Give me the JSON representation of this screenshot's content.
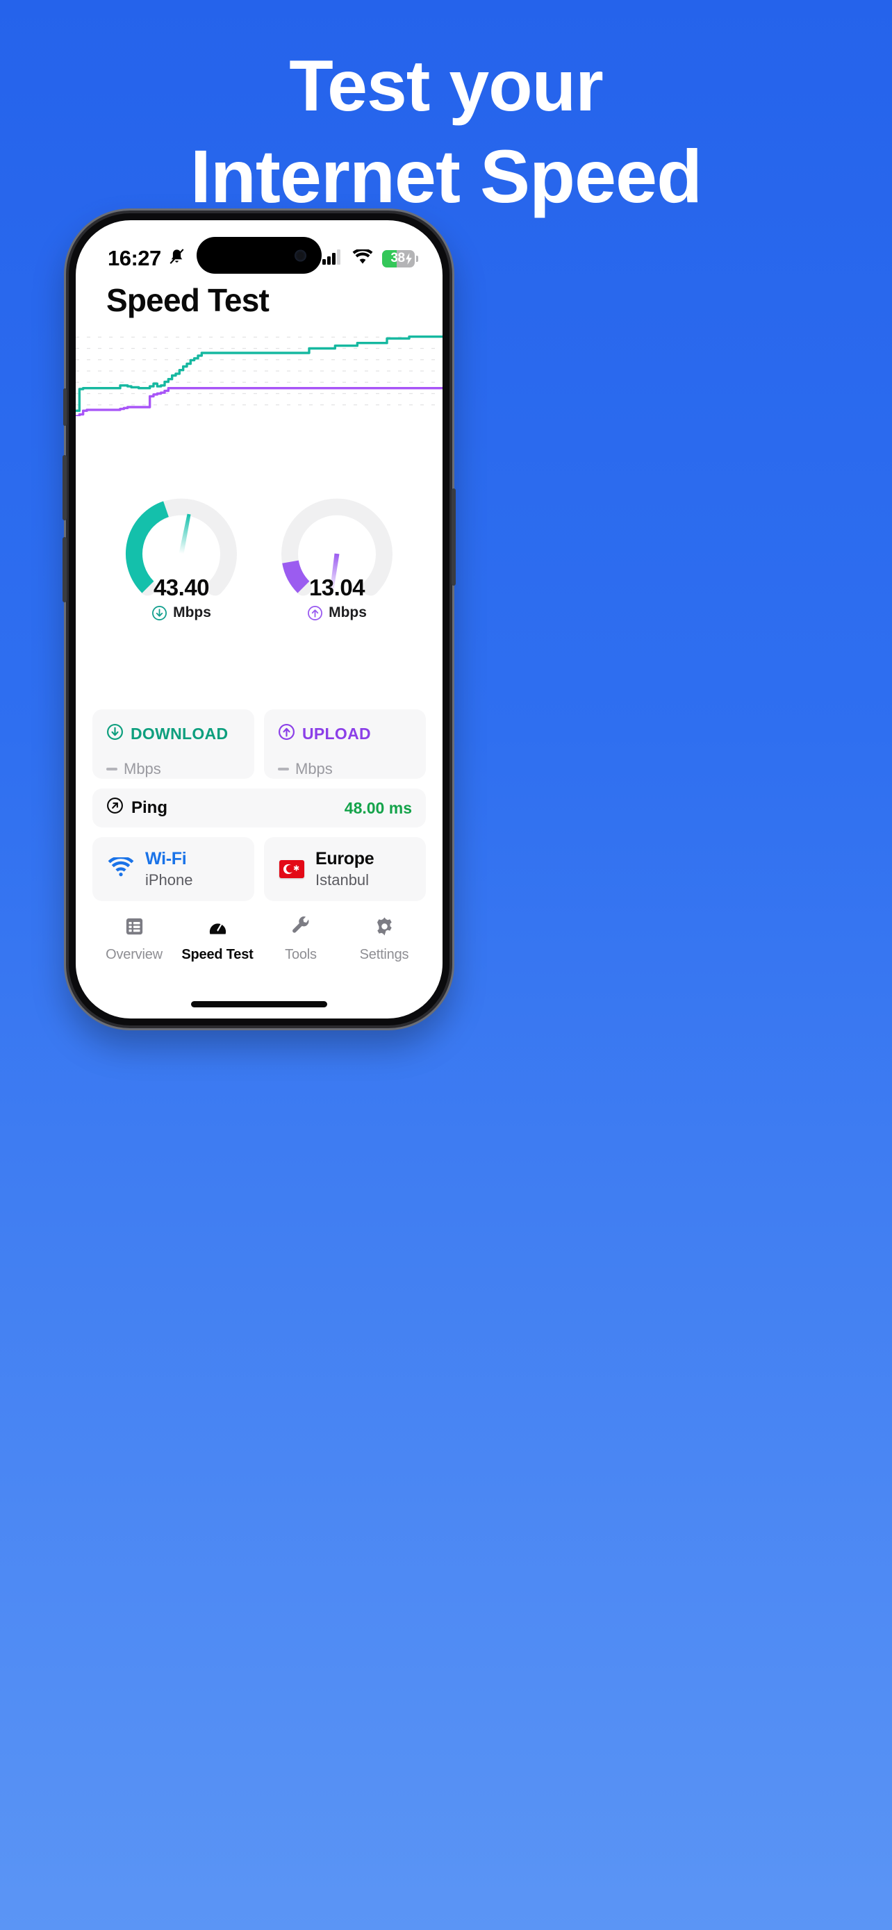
{
  "promo": {
    "headline_line1": "Test your",
    "headline_line2": "Internet Speed",
    "bg_color": "#2563eb"
  },
  "status_bar": {
    "time": "16:27",
    "silent_icon": "bell-muted-icon",
    "cellular_icon": "cellular-bars-icon",
    "wifi_icon": "wifi-icon",
    "battery_percent": "38",
    "battery_charging": true,
    "battery_color": "#34c759"
  },
  "app": {
    "title": "Speed Test"
  },
  "chart_data": {
    "type": "line",
    "title": "",
    "xlabel": "",
    "ylabel": "",
    "grid": true,
    "legend_position": "none",
    "ylim": [
      0,
      100
    ],
    "xlim": [
      0,
      100
    ],
    "series": [
      {
        "name": "Download",
        "color": "#16b8a0",
        "values": [
          6,
          30,
          31,
          31,
          31,
          31,
          31,
          31,
          31,
          31,
          31,
          31,
          34,
          34,
          33,
          32,
          32,
          31,
          31,
          31,
          33,
          36,
          33,
          34,
          38,
          41,
          45,
          47,
          51,
          55,
          58,
          62,
          64,
          67,
          70,
          70,
          70,
          70,
          70,
          70,
          70,
          70,
          70,
          70,
          70,
          70,
          70,
          70,
          70,
          70,
          70,
          70,
          70,
          70,
          70,
          70,
          70,
          70,
          70,
          70,
          70,
          70,
          70,
          75,
          75,
          75,
          75,
          75,
          75,
          75,
          78,
          78,
          78,
          78,
          78,
          78,
          81,
          81,
          81,
          81,
          81,
          81,
          81,
          81,
          86,
          86,
          86,
          86,
          86,
          86,
          88,
          88,
          88,
          88,
          88,
          88,
          88,
          88,
          88,
          88
        ]
      },
      {
        "name": "Upload",
        "color": "#a855f7",
        "values": [
          0,
          2,
          6,
          7,
          7,
          7,
          7,
          7,
          7,
          7,
          7,
          7,
          8,
          9,
          10,
          10,
          10,
          10,
          10,
          10,
          22,
          24,
          25,
          26,
          28,
          31,
          31,
          31,
          31,
          31,
          31,
          31,
          31,
          31,
          31,
          31,
          31,
          31,
          31,
          31,
          31,
          31,
          31,
          31,
          31,
          31,
          31,
          31,
          31,
          31,
          31,
          31,
          31,
          31,
          31,
          31,
          31,
          31,
          31,
          31,
          31,
          31,
          31,
          31,
          31,
          31,
          31,
          31,
          31,
          31,
          31,
          31,
          31,
          31,
          31,
          31,
          31,
          31,
          31,
          31,
          31,
          31,
          31,
          31,
          31,
          31,
          31,
          31,
          31,
          31,
          31,
          31,
          31,
          31,
          31,
          31,
          31,
          31,
          31,
          31
        ]
      }
    ]
  },
  "gauges": [
    {
      "name": "download",
      "value": "43.40",
      "unit": "Mbps",
      "icon": "arrow-down-circle-icon",
      "color": "#14c0ab",
      "track_color": "#f0f0f1",
      "arc_fraction": 0.43,
      "needle_angle_deg": 10
    },
    {
      "name": "upload",
      "value": "13.04",
      "unit": "Mbps",
      "icon": "arrow-up-circle-icon",
      "color": "#9b5cf0",
      "track_color": "#f0f0f1",
      "arc_fraction": 0.13,
      "needle_angle_deg": 97
    }
  ],
  "result_cards": {
    "download": {
      "label": "DOWNLOAD",
      "icon": "arrow-down-circle-icon",
      "value": "",
      "unit": "Mbps",
      "color": "#0e9f7e"
    },
    "upload": {
      "label": "UPLOAD",
      "icon": "arrow-up-circle-icon",
      "value": "",
      "unit": "Mbps",
      "color": "#8b3fe8"
    }
  },
  "ping": {
    "label": "Ping",
    "icon": "arrow-up-right-circle-icon",
    "value": "48.00 ms",
    "color": "#14a34a"
  },
  "connection": {
    "type_label": "Wi-Fi",
    "type_sub": "iPhone",
    "icon": "wifi-icon",
    "type_color": "#1a73e8"
  },
  "server": {
    "region_label": "Europe",
    "city": "Istanbul",
    "flag": "turkey-flag-icon"
  },
  "tabs": [
    {
      "label": "Overview",
      "icon": "list-icon",
      "active": false
    },
    {
      "label": "Speed Test",
      "icon": "gauge-icon",
      "active": true
    },
    {
      "label": "Tools",
      "icon": "wrench-icon",
      "active": false
    },
    {
      "label": "Settings",
      "icon": "gear-icon",
      "active": false
    }
  ]
}
